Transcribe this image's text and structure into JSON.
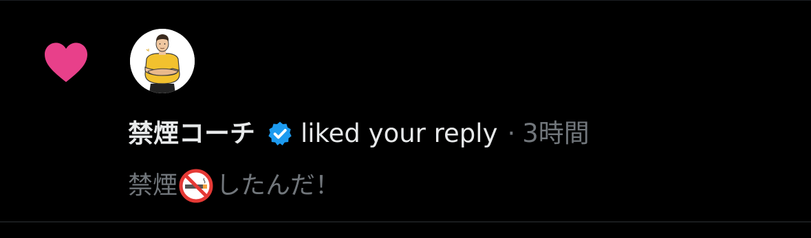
{
  "notification": {
    "type_icon": "heart-icon",
    "avatar_icon": "coach-avatar-icon",
    "author_name": "禁煙コーチ",
    "verified_icon": "verified-badge-icon",
    "action": "liked your reply",
    "separator": "·",
    "time": "3時間",
    "preview": {
      "text_before": "禁煙",
      "emoji_icon": "no-smoking-icon",
      "text_after": "したんだ！"
    }
  },
  "colors": {
    "background": "#000000",
    "heart": "#f91880",
    "verified": "#1d9bf0",
    "primary_text": "#e7e9ea",
    "secondary_text": "#71767b"
  }
}
